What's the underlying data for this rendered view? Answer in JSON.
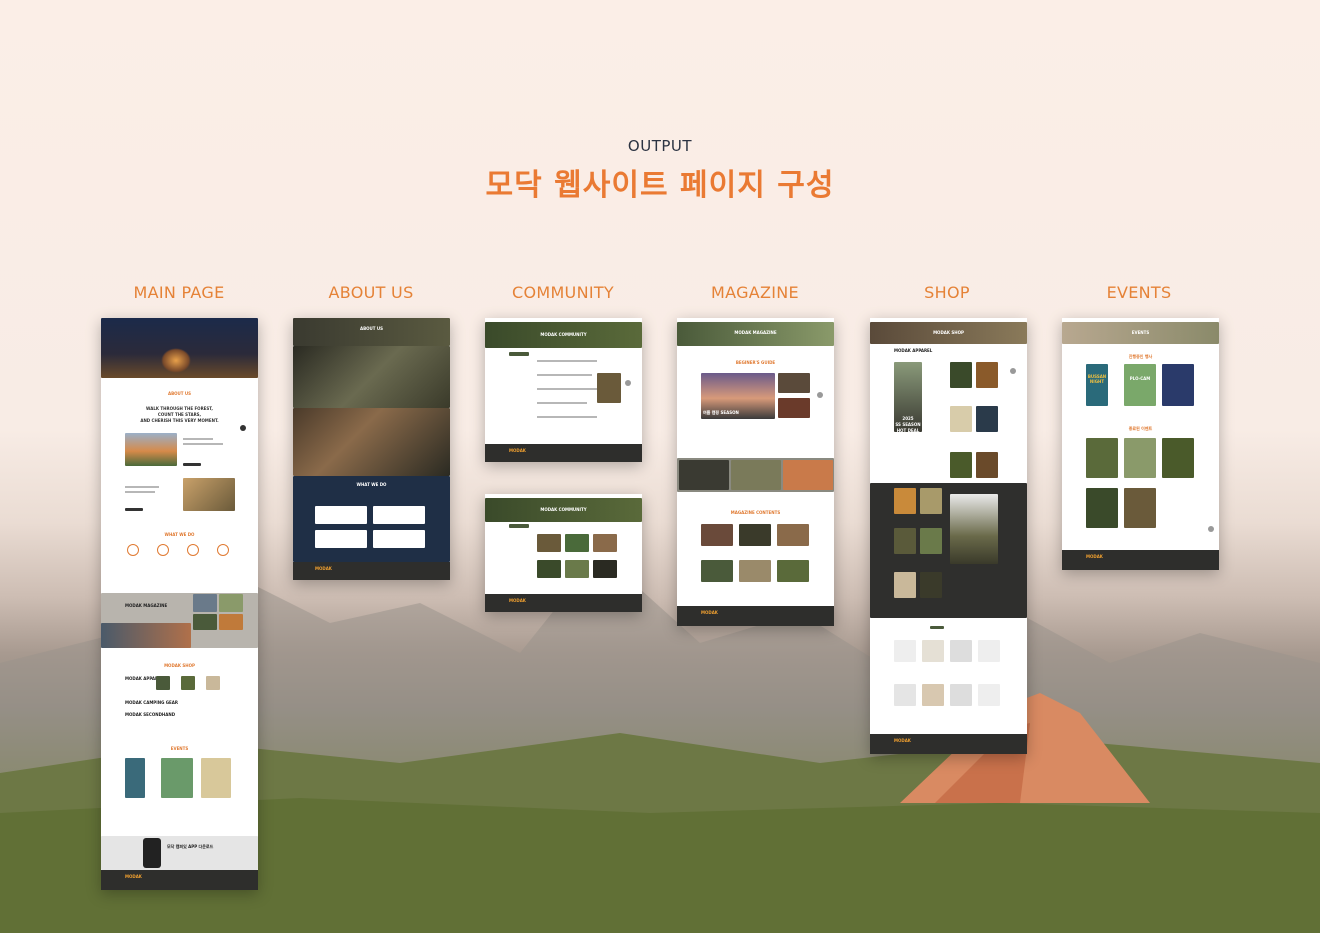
{
  "header": {
    "eyebrow": "OUTPUT",
    "title": "모닥 웹사이트 페이지 구성"
  },
  "columns": [
    {
      "label": "MAIN PAGE"
    },
    {
      "label": "ABOUT US"
    },
    {
      "label": "COMMUNITY"
    },
    {
      "label": "MAGAZINE"
    },
    {
      "label": "SHOP"
    },
    {
      "label": "EVENTS"
    }
  ],
  "screens": {
    "main": {
      "about_heading": "ABOUT US",
      "tagline_1": "WALK THROUGH THE FOREST,",
      "tagline_2": "COUNT THE STARS,",
      "tagline_3": "AND CHERISH THIS VERY MOMENT.",
      "whatwedo": "WHAT WE DO",
      "magazine": "MODAK MAGAZINE",
      "shop": "MODAK SHOP",
      "shop_apparel": "MODAK APPAREL",
      "shop_gear": "MODAK CAMPING GEAR",
      "shop_second": "MODAK SECONDHAND",
      "events": "EVENTS",
      "app_text": "모닥 캠퍼있 APP 다운로드",
      "logo": "MODAK"
    },
    "about": {
      "banner": "ABOUT US",
      "whatwedo": "WHAT WE DO",
      "logo": "MODAK"
    },
    "community": {
      "banner": "MODAK COMMUNITY",
      "logo": "MODAK"
    },
    "magazine": {
      "banner": "MODAK MAGAZINE",
      "section_1": "BEGINER'S GUIDE",
      "section_2": "MAGAZINE CONTENTS",
      "hero_caption": "여름 캠핑 SEASON",
      "logo": "MODAK"
    },
    "shop": {
      "banner": "MODAK SHOP",
      "category": "MODAK APPAREL",
      "promo_1": "2025",
      "promo_2": "SS SEASON",
      "promo_3": "HOT DEAL",
      "logo": "MODAK"
    },
    "events": {
      "banner": "EVENTS",
      "section_1": "진행중인 행사",
      "section_2": "종료된 이벤트",
      "poster_1": "BUSSAN NIGHT",
      "poster_2": "PLO-CAM",
      "logo": "MODAK"
    }
  },
  "colors": {
    "accent": "#ea7a33",
    "navy": "#2b3342",
    "dark": "#2f2f2d",
    "forest": "#3a4a2a"
  }
}
